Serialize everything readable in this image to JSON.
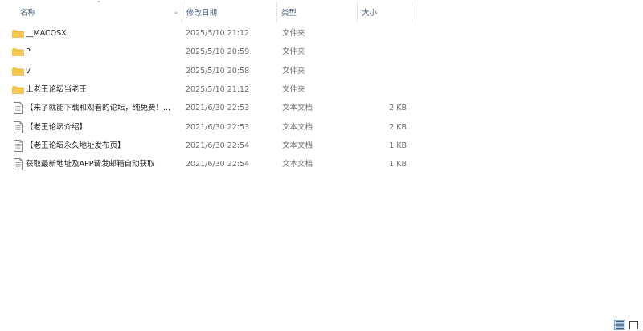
{
  "columns": {
    "name": "名称",
    "date": "修改日期",
    "type": "类型",
    "size": "大小"
  },
  "files": [
    {
      "name": "__MACOSX",
      "date": "2025/5/10 21:12",
      "type": "文件夹",
      "size": "",
      "icon": "folder-icon"
    },
    {
      "name": "P",
      "date": "2025/5/10 20:59",
      "type": "文件夹",
      "size": "",
      "icon": "folder-icon"
    },
    {
      "name": "v",
      "date": "2025/5/10 20:58",
      "type": "文件夹",
      "size": "",
      "icon": "folder-icon"
    },
    {
      "name": "上老王论坛当老王",
      "date": "2025/5/10 21:12",
      "type": "文件夹",
      "size": "",
      "icon": "folder-icon"
    },
    {
      "name": "【来了就能下载和观看的论坛，纯免费！...",
      "date": "2021/6/30 22:53",
      "type": "文本文档",
      "size": "2 KB",
      "icon": "text-file-icon"
    },
    {
      "name": "【老王论坛介绍】",
      "date": "2021/6/30 22:53",
      "type": "文本文档",
      "size": "2 KB",
      "icon": "text-file-icon"
    },
    {
      "name": "【老王论坛永久地址发布页】",
      "date": "2021/6/30 22:54",
      "type": "文本文档",
      "size": "1 KB",
      "icon": "text-file-icon"
    },
    {
      "name": "获取最新地址及APP请发邮箱自动获取",
      "date": "2021/6/30 22:54",
      "type": "文本文档",
      "size": "1 KB",
      "icon": "text-file-icon"
    }
  ],
  "colors": {
    "folder": "#f7c74e",
    "header_text": "#4c607a",
    "secondary_text": "#6d6d6d"
  }
}
